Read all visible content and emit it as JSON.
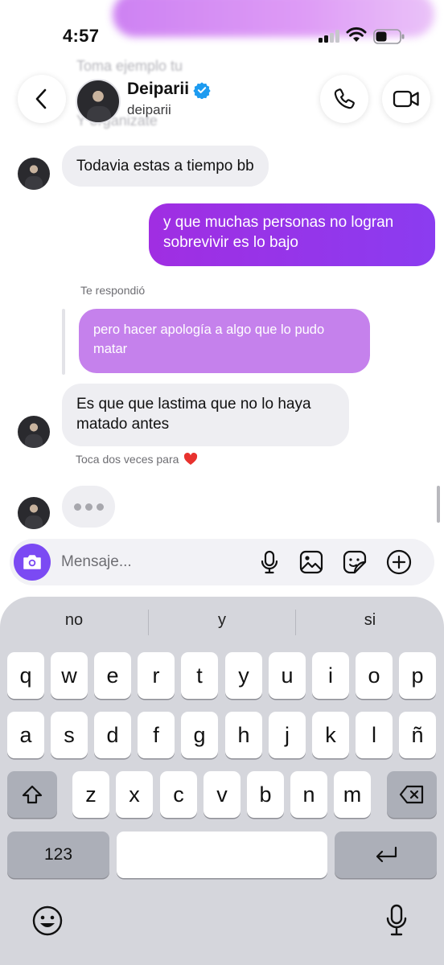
{
  "status_bar": {
    "time": "4:57"
  },
  "background_messages": [
    "Toma ejemplo tu",
    "Y organizate"
  ],
  "header": {
    "name": "Deiparii",
    "handle": "deiparii"
  },
  "messages": {
    "m1": "Todavia estas a tiempo bb",
    "m2": "y que muchas personas no logran sobrevivir es lo bajo",
    "reply_label": "Te respondió",
    "quoted": "pero hacer apología a algo que lo pudo matar",
    "m3": "Es que que lastima que no lo haya matado antes",
    "hint": "Toca dos veces para"
  },
  "composer": {
    "placeholder": "Mensaje..."
  },
  "keyboard": {
    "suggestions": [
      "no",
      "y",
      "si"
    ],
    "row1": [
      "q",
      "w",
      "e",
      "r",
      "t",
      "y",
      "u",
      "i",
      "o",
      "p"
    ],
    "row2": [
      "a",
      "s",
      "d",
      "f",
      "g",
      "h",
      "j",
      "k",
      "l",
      "ñ"
    ],
    "row3": [
      "z",
      "x",
      "c",
      "v",
      "b",
      "n",
      "m"
    ],
    "numbers_key": "123"
  },
  "colors": {
    "outgoing_bubble": "#9a34e6",
    "quoted_bubble": "#c581ec",
    "incoming_bubble": "#eeeef2",
    "camera_button": "#7b4af3",
    "verified_badge": "#1d9bf0",
    "heart": "#e8322e"
  },
  "icons": {
    "header": [
      "chevron-left-icon",
      "verified-badge-icon",
      "phone-icon",
      "video-camera-icon"
    ],
    "composer": [
      "camera-icon",
      "microphone-icon",
      "image-icon",
      "sticker-icon",
      "plus-circle-icon"
    ],
    "keyboard": [
      "shift-icon",
      "delete-icon",
      "return-icon",
      "emoji-icon",
      "dictation-icon"
    ]
  }
}
